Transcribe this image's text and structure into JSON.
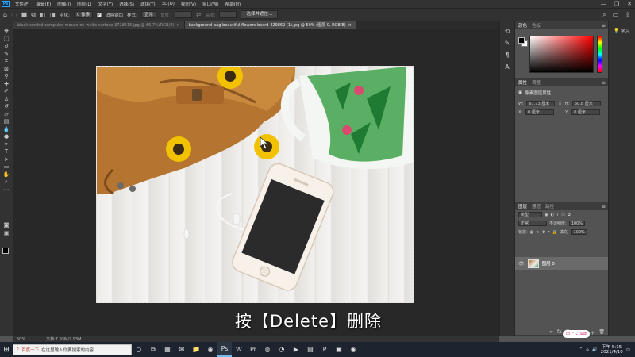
{
  "menu": {
    "logo": "Ps",
    "items": [
      "文件(F)",
      "编辑(E)",
      "图像(I)",
      "图层(L)",
      "文字(Y)",
      "选择(S)",
      "滤镜(T)",
      "3D(D)",
      "视图(V)",
      "窗口(W)",
      "帮助(H)"
    ],
    "window_controls": [
      "—",
      "❐",
      "✕"
    ]
  },
  "options": {
    "feather_label": "羽化:",
    "feather_value": "0 像素",
    "antialias_label": "消除锯齿",
    "style_label": "样式:",
    "style_value": "正常",
    "width_label": "宽度:",
    "height_label": "高度:",
    "select_mask_button": "选择并遮住..."
  },
  "tabs": [
    {
      "title": "black-corded-computer-mouse-on-white-surface-3728515.jpg @ 66.7%(RGB/8)",
      "close": "×"
    },
    {
      "title": "background-bag-beautiful-flowers-board-429862 (1).jpg @ 50% (图层 0, RGB/8)",
      "close": "×"
    }
  ],
  "subtitle": "按【Delete】删除",
  "status": {
    "zoom": "50%",
    "doc": "文档:7.93M/7.93M"
  },
  "color_panel": {
    "tabs": [
      "颜色",
      "色板"
    ],
    "accent_colors": {
      "hue": "#ff0000"
    }
  },
  "properties_panel": {
    "tabs": [
      "属性",
      "调整"
    ],
    "section": "像素图层属性",
    "w_label": "W:",
    "w_value": "67.73 厘米",
    "h_label": "H:",
    "h_value": "50.8 厘米",
    "x_label": "X:",
    "x_value": "0 厘米",
    "y_label": "Y:",
    "y_value": "0 厘米"
  },
  "layers_panel": {
    "tabs": [
      "图层",
      "通道",
      "路径"
    ],
    "filter_label": "类型",
    "blend_mode": "正常",
    "opacity_label": "不透明度:",
    "opacity_value": "100%",
    "lock_label": "锁定:",
    "fill_label": "填充:",
    "fill_value": "100%",
    "layer_name": "图层 0"
  },
  "learn": {
    "label": "学习"
  },
  "taskbar": {
    "search_prefix": "百度一下",
    "search_hint": "在这里输入你要搜索的内容",
    "ime": "中",
    "clock_time": "下午 5:15",
    "clock_date": "2021/4/10"
  }
}
